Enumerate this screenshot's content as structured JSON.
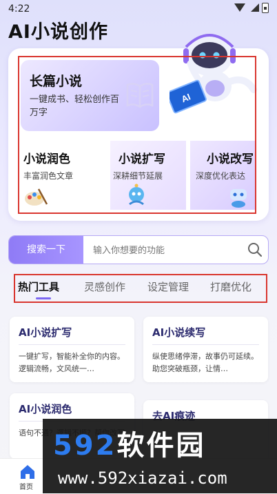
{
  "status_bar": {
    "time": "4:22"
  },
  "app": {
    "title": "AI小说创作"
  },
  "hero": {
    "long_novel": {
      "title": "长篇小说",
      "subtitle": "一键成书、轻松创作百万字"
    },
    "features": [
      {
        "title": "小说润色",
        "subtitle": "丰富润色文章",
        "icon": "palette-icon"
      },
      {
        "title": "小说扩写",
        "subtitle": "深耕细节延展",
        "icon": "robot-head-icon"
      },
      {
        "title": "小说改写",
        "subtitle": "深度优化表达",
        "icon": "bot-icon"
      }
    ],
    "robot_screen_label": "AI"
  },
  "search": {
    "button_label": "搜索一下",
    "placeholder": "输入你想要的功能"
  },
  "tabs": [
    {
      "label": "热门工具",
      "active": true
    },
    {
      "label": "灵感创作",
      "active": false
    },
    {
      "label": "设定管理",
      "active": false
    },
    {
      "label": "打磨优化",
      "active": false
    }
  ],
  "cards": [
    {
      "title": "AI小说扩写",
      "desc": "一键扩写，智能补全你的内容。逻辑流畅，文风统一…"
    },
    {
      "title": "AI小说续写",
      "desc": "纵使思绪停滞，故事仍可延续。助您突破瓶颈，让情…"
    },
    {
      "title": "AI小说润色",
      "desc": "语句不通？逻辑不顺？帮你改写"
    },
    {
      "title": "去AI痕迹",
      "desc": ""
    }
  ],
  "bottom_nav": {
    "home_label": "首页"
  },
  "watermark": {
    "big_num": "592",
    "big_cn": "软件园",
    "url": "www.592xiazai.com"
  },
  "colors": {
    "accent": "#8f7bf6",
    "highlight": "#d9352e",
    "card_title": "#2b2a6e"
  }
}
